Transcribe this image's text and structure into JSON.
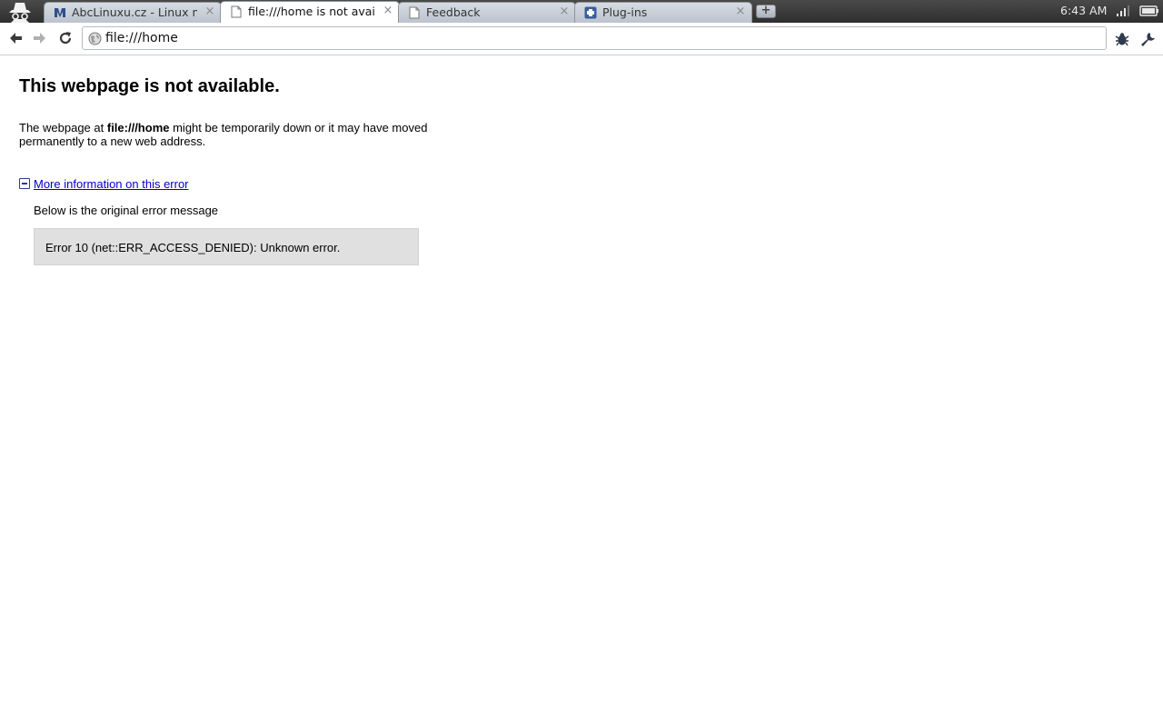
{
  "tabs": [
    {
      "title": "AbcLinuxu.cz - Linux na...",
      "icon": "abclinuxu-favicon-icon",
      "active": false
    },
    {
      "title": "file:///home is not avail...",
      "icon": "page-icon",
      "active": true
    },
    {
      "title": "Feedback",
      "icon": "page-icon",
      "active": false
    },
    {
      "title": "Plug-ins",
      "icon": "puzzle-icon",
      "active": false
    }
  ],
  "tab_close_glyph": "×",
  "newtab_glyph": "+",
  "system": {
    "clock": "6:43 AM"
  },
  "omnibox": {
    "url": "file:///home"
  },
  "page": {
    "heading": "This webpage is not available.",
    "desc_prefix": "The webpage at ",
    "desc_url": "file:///home",
    "desc_suffix": " might be temporarily down or it may have moved permanently to a new web address.",
    "more_link": "More information on this error",
    "below": "Below is the original error message",
    "error": "Error 10 (net::ERR_ACCESS_DENIED): Unknown error."
  },
  "colors": {
    "link": "#0000cc",
    "tabstrip": "#3a3a3a",
    "error_box": "#e0e0e0"
  }
}
